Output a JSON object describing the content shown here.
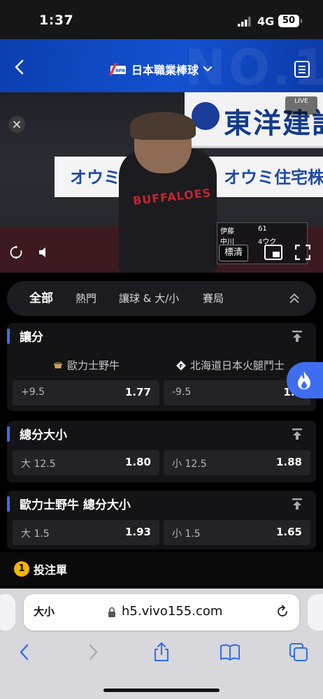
{
  "status_bar": {
    "time": "1:37",
    "network": "4G",
    "battery": "50"
  },
  "header": {
    "title": "日本職業棒球",
    "watermark": "NO.1"
  },
  "video": {
    "banner_top": "東洋建設",
    "banner_mid_1": "オウミ住",
    "banner_mid_2": "オウミ住宅株",
    "jersey": "BUFFALOES",
    "live": "LIVE",
    "quality": "標清",
    "scoreboard": {
      "inning": "61",
      "row1": "伊藤",
      "row2": "中川",
      "pitch": "4ウク"
    }
  },
  "tabs": [
    {
      "label": "全部"
    },
    {
      "label": "熱門"
    },
    {
      "label": "讓球 & 大/小"
    },
    {
      "label": "賽局"
    }
  ],
  "markets": {
    "handicap": {
      "title": "讓分",
      "home_team": "歐力士野牛",
      "away_team": "北海道日本火腿鬥士",
      "odds": [
        {
          "label": "+9.5",
          "value": "1.77"
        },
        {
          "label": "-9.5",
          "value": "1.9"
        }
      ]
    },
    "total": {
      "title": "總分大小",
      "odds": [
        {
          "label": "大 12.5",
          "value": "1.80"
        },
        {
          "label": "小 12.5",
          "value": "1.88"
        }
      ]
    },
    "team_total": {
      "title": "歐力士野牛 總分大小",
      "odds": [
        {
          "label": "大 1.5",
          "value": "1.93"
        },
        {
          "label": "小 1.5",
          "value": "1.65"
        }
      ]
    }
  },
  "betslip": {
    "count": "1",
    "label": "投注單"
  },
  "browser": {
    "text_size": "大小",
    "url": "h5.vivo155.com"
  },
  "colors": {
    "accent": "#3f6df0",
    "header_blue": "#1351d0",
    "badge_yellow": "#f4b400"
  }
}
